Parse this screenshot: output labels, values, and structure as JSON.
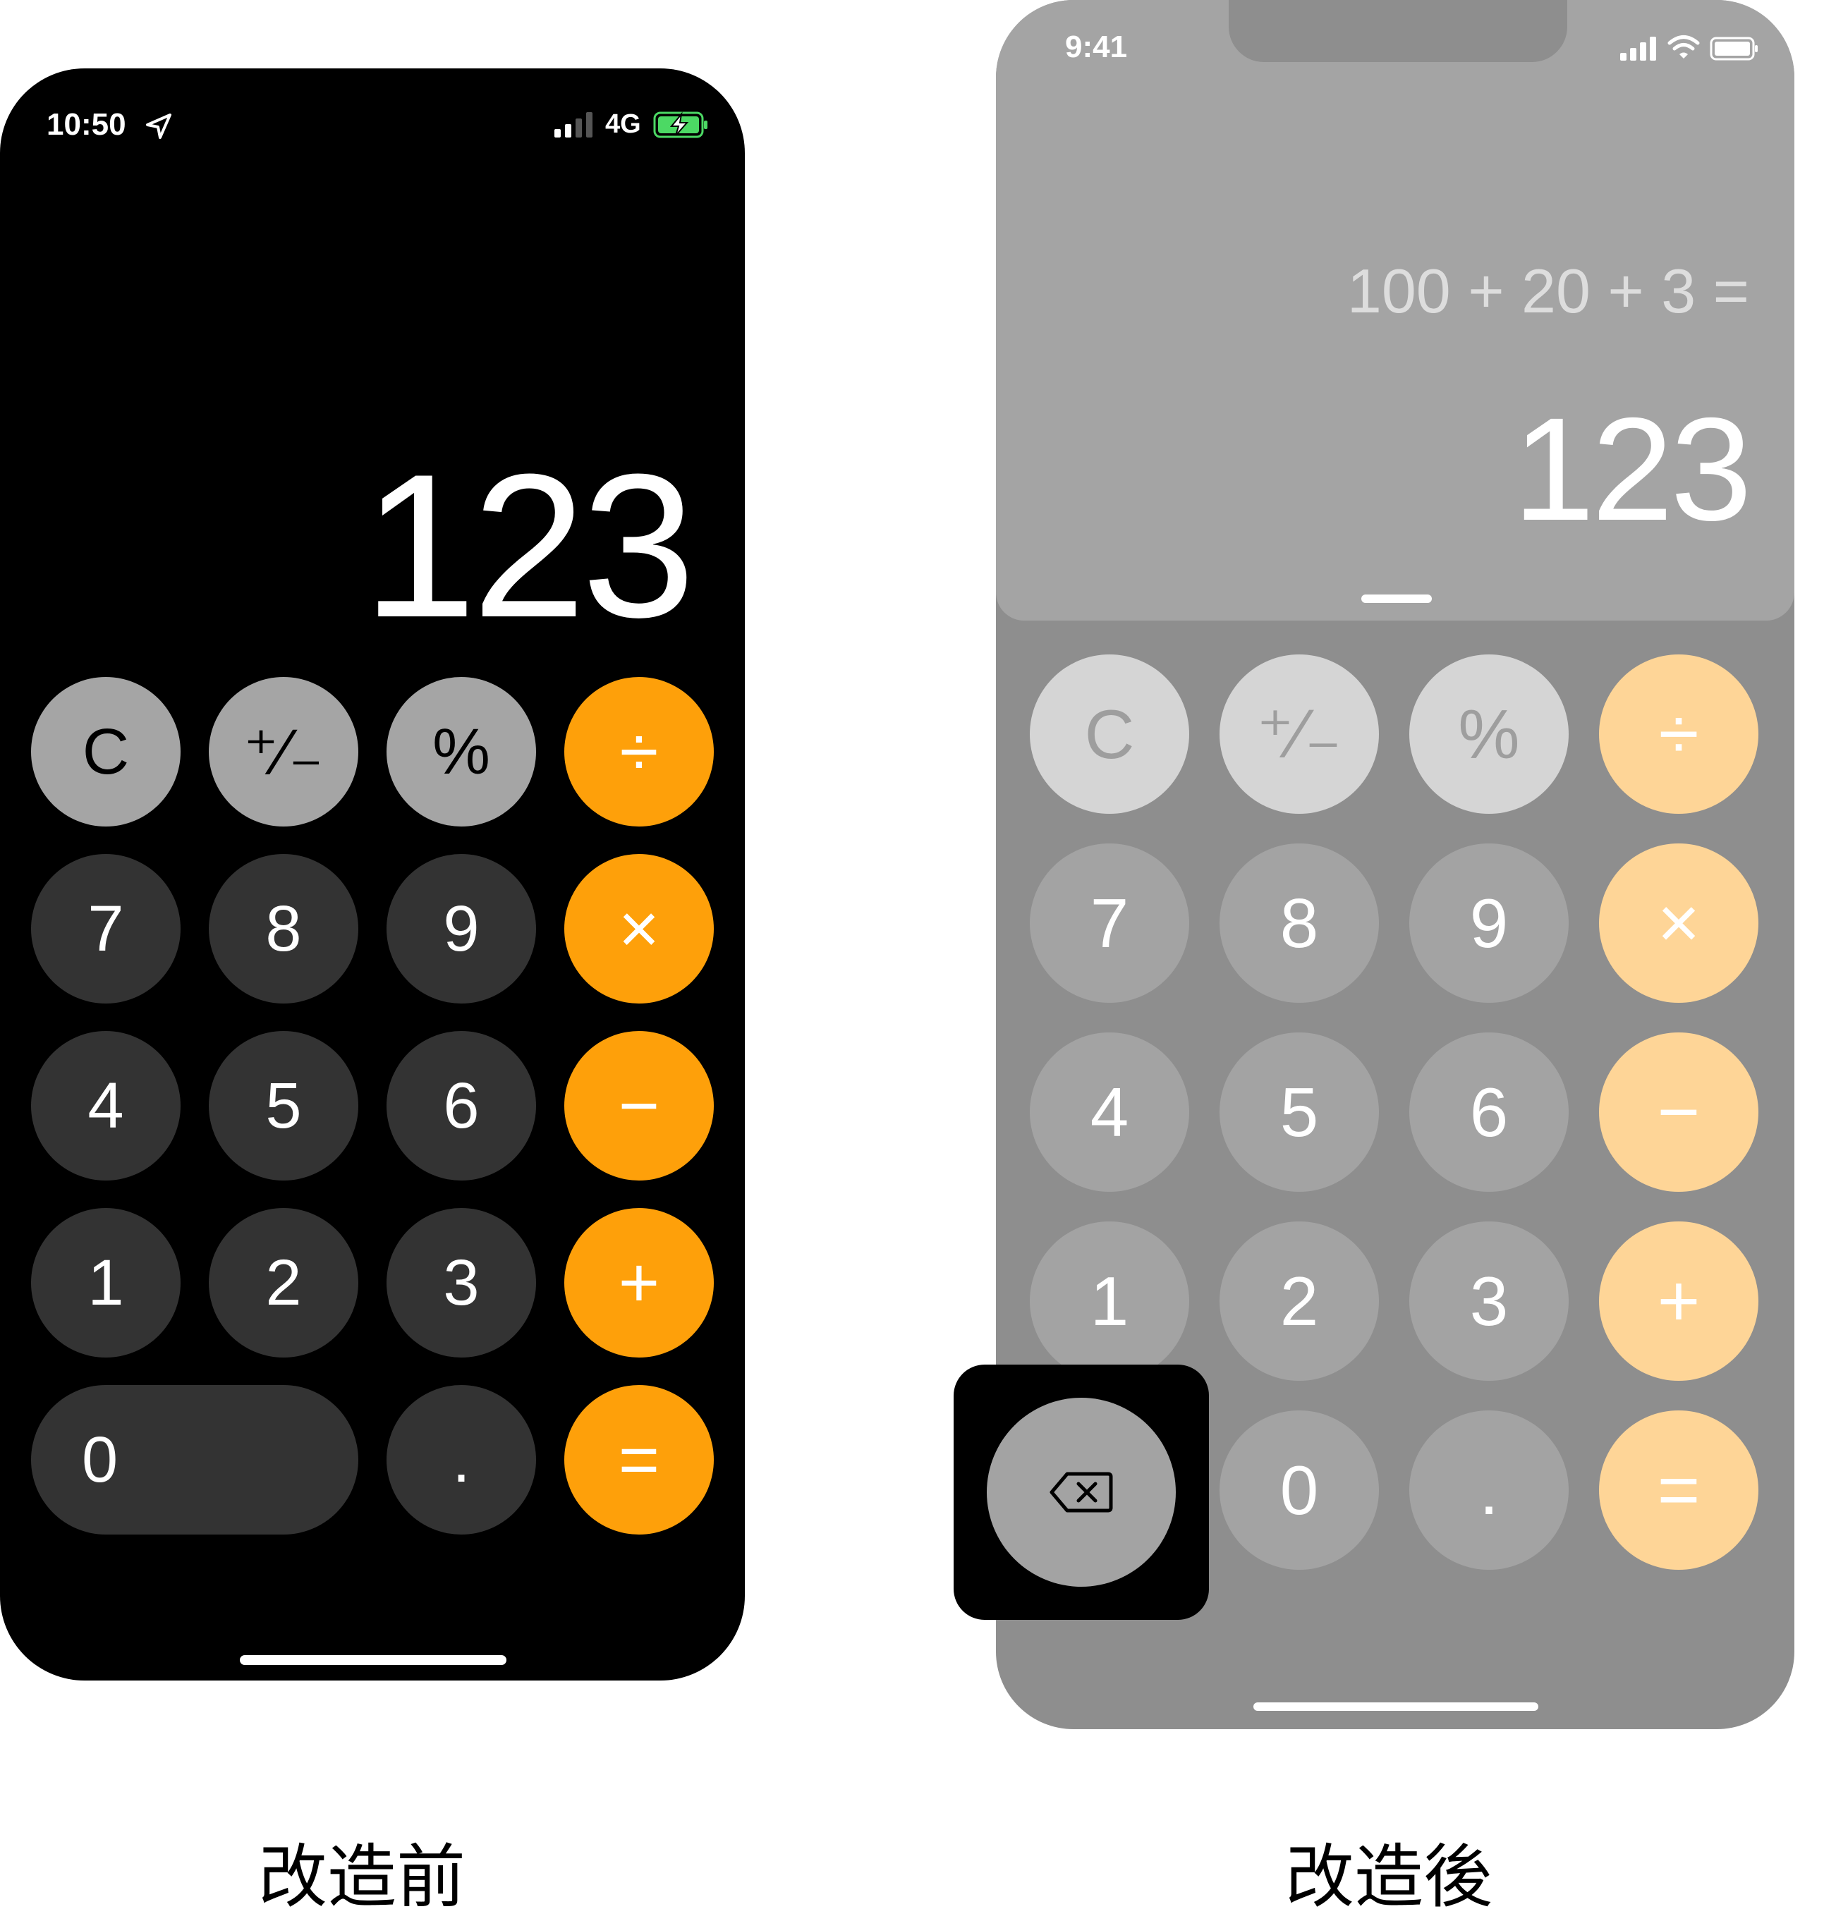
{
  "before": {
    "status": {
      "time": "10:50",
      "network": "4G"
    },
    "display": "123",
    "keys": [
      "C",
      "⁺∕₋",
      "%",
      "÷",
      "7",
      "8",
      "9",
      "×",
      "4",
      "5",
      "6",
      "−",
      "1",
      "2",
      "3",
      "+",
      "0",
      ".",
      "="
    ],
    "caption": "改造前"
  },
  "after": {
    "status": {
      "time": "9:41"
    },
    "expression": "100 + 20 + 3 =",
    "display": "123",
    "keys": [
      "C",
      "⁺∕₋",
      "%",
      "÷",
      "7",
      "8",
      "9",
      "×",
      "4",
      "5",
      "6",
      "−",
      "1",
      "2",
      "3",
      "+",
      "0",
      ".",
      "="
    ],
    "caption": "改造後"
  },
  "colors": {
    "operator": "#fea00a",
    "operator_dimmed": "#fed597",
    "function_key": "#a5a5a5",
    "number_key": "#333333"
  }
}
